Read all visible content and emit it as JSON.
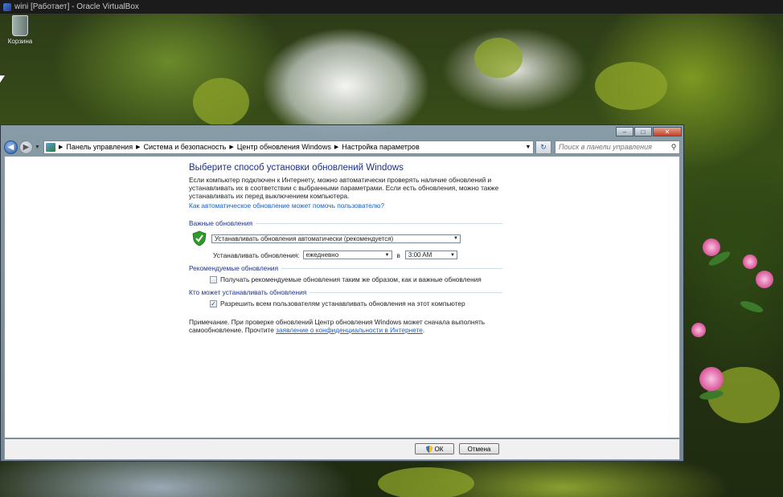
{
  "host": {
    "title": "winі [Работает] - Oracle VirtualBox"
  },
  "desktop": {
    "recycle_bin_label": "Корзина"
  },
  "address_bar": {
    "crumbs": [
      "Панель управления",
      "Система и безопасность",
      "Центр обновления Windows",
      "Настройка параметров"
    ],
    "search_placeholder": "Поиск в панели управления"
  },
  "main": {
    "title": "Выберите способ установки обновлений Windows",
    "intro": "Если компьютер подключен к Интернету, можно автоматически проверять наличие обновлений и устанавливать их в соответствии с выбранными параметрами. Если есть обновления, можно также устанавливать их перед выключением компьютера.",
    "help_link": "Как автоматическое обновление может помочь пользователю?",
    "important": {
      "title": "Важные обновления",
      "mode_value": "Устанавливать обновления автоматически (рекомендуется)",
      "schedule_label": "Устанавливать обновления:",
      "day_value": "ежедневно",
      "at_label": "в",
      "time_value": "3:00 AM"
    },
    "recommended": {
      "title": "Рекомендуемые обновления",
      "checkbox_label": "Получать рекомендуемые обновления таким же образом, как и важные обновления",
      "checked": false
    },
    "who": {
      "title": "Кто может устанавливать обновления",
      "checkbox_label": "Разрешить всем пользователям устанавливать обновления на этот компьютер",
      "checked": true
    },
    "note_text": "Примечание. При проверке обновлений Центр обновления Windows может сначала выполнять самообновление. Прочтите ",
    "note_link": "заявление о конфиденциальности в Интернете",
    "note_end": "."
  },
  "buttons": {
    "ok": "ОК",
    "cancel": "Отмена"
  },
  "colors": {
    "heading_blue": "#1e3287",
    "link_blue": "#1a5fc0",
    "shield_green": "#2f9a2a"
  },
  "icons": {
    "shield": "shield-check-icon",
    "recycle_bin": "recycle-bin-icon",
    "search": "search-icon",
    "refresh": "refresh-icon"
  }
}
